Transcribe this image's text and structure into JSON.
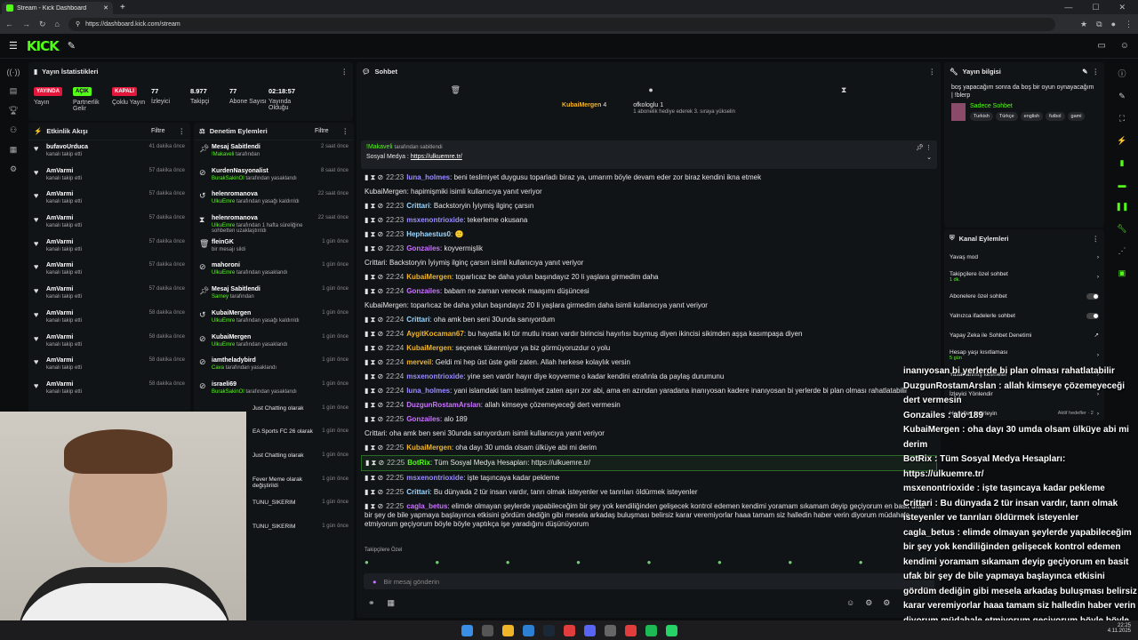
{
  "browser": {
    "tab_title": "Stream - Kick Dashboard",
    "url": "https://dashboard.kick.com/stream"
  },
  "logo": "KICK",
  "stats": {
    "title": "Yayın İstatistikleri",
    "items": [
      {
        "badge": "YAYINDA",
        "badge_color": "#e3173a",
        "label": "Yayın"
      },
      {
        "badge": "AÇIK",
        "badge_color": "#53fc18",
        "label": "Partnerlik Gelir"
      },
      {
        "badge": "KAPALI",
        "badge_color": "#e3173a",
        "label": "Çoklu Yayın"
      },
      {
        "value": "77",
        "label": "İzleyici"
      },
      {
        "value": "8.977",
        "label": "Takipçi"
      },
      {
        "value": "77",
        "label": "Abone Sayısı"
      },
      {
        "value": "02:18:57",
        "label": "Yayında Olduğu"
      }
    ]
  },
  "activity": {
    "title": "Etkinlik Akışı",
    "filter": "Filtre",
    "items": [
      {
        "name": "bufavoUrduca",
        "sub": "kanalı takip etti",
        "time": "41 dakika önce"
      },
      {
        "name": "AmVarmi",
        "sub": "kanalı takip etti",
        "time": "57 dakika önce"
      },
      {
        "name": "AmVarmi",
        "sub": "kanalı takip etti",
        "time": "57 dakika önce"
      },
      {
        "name": "AmVarmi",
        "sub": "kanalı takip etti",
        "time": "57 dakika önce"
      },
      {
        "name": "AmVarmi",
        "sub": "kanalı takip etti",
        "time": "57 dakika önce"
      },
      {
        "name": "AmVarmi",
        "sub": "kanalı takip etti",
        "time": "57 dakika önce"
      },
      {
        "name": "AmVarmi",
        "sub": "kanalı takip etti",
        "time": "57 dakika önce"
      },
      {
        "name": "AmVarmi",
        "sub": "kanalı takip etti",
        "time": "58 dakika önce"
      },
      {
        "name": "AmVarmi",
        "sub": "kanalı takip etti",
        "time": "58 dakika önce"
      },
      {
        "name": "AmVarmi",
        "sub": "kanalı takip etti",
        "time": "58 dakika önce"
      },
      {
        "name": "AmVarmi",
        "sub": "kanalı takip etti",
        "time": "58 dakika önce"
      }
    ]
  },
  "moderation": {
    "title": "Denetim Eylemleri",
    "filter": "Filtre",
    "items": [
      {
        "name": "Mesaj Sabitlendi",
        "who": "!Makaveli",
        "sub": "tarafından",
        "time": "2 saat önce"
      },
      {
        "name": "KurdenNasyonalist",
        "who": "BurakSakinOl",
        "sub": "tarafından yasaklandı",
        "time": "8 saat önce"
      },
      {
        "name": "helenromanova",
        "who": "UlkuEmre",
        "sub": "tarafından yasağı kaldırıldı",
        "time": "22 saat önce"
      },
      {
        "name": "helenromanova",
        "who": "UlkuEmre",
        "sub": "tarafından 1 hafta süreliğine sohbetten uzaklaştırıldı",
        "time": "22 saat önce"
      },
      {
        "name": "fleinGK",
        "who": "",
        "sub": "bir mesajı sildi",
        "time": "1 gün önce"
      },
      {
        "name": "mahoroni",
        "who": "UlkuEmre",
        "sub": "tarafından yasaklandı",
        "time": "1 gün önce"
      },
      {
        "name": "Mesaj Sabitlendi",
        "who": "Sarney",
        "sub": "tarafından",
        "time": "1 gün önce"
      },
      {
        "name": "KubaiMergen",
        "who": "UlkuEmre",
        "sub": "tarafından yasağı kaldırıldı",
        "time": "1 gün önce"
      },
      {
        "name": "KubaiMergen",
        "who": "UlkuEmre",
        "sub": "tarafından yasaklandı",
        "time": "1 gün önce"
      },
      {
        "name": "iamtheladybird",
        "who": "Cava",
        "sub": "tarafından yasaklandı",
        "time": "1 gün önce"
      },
      {
        "name": "israeli69",
        "who": "BurakSakinOl",
        "sub": "tarafından yasaklandı",
        "time": "1 gün önce"
      }
    ]
  },
  "mod_partial": [
    {
      "text": "Just Chatting olarak",
      "time": "1 gün önce"
    },
    {
      "text": "EA Sports FC 26 olarak",
      "time": "1 gün önce"
    },
    {
      "text": "Just Chatting olarak",
      "time": "1 gün önce"
    },
    {
      "text": "Fever Meme olarak değiştirildi",
      "time": "1 gün önce"
    },
    {
      "text": "TUNU_SIKERIM",
      "time": "1 gün önce"
    },
    {
      "text": "TUNU_SIKERIM",
      "time": "1 gün önce"
    }
  ],
  "chat": {
    "title": "Sohbet",
    "top_user": "KubaiMergen",
    "top_count": "4",
    "gift_user": "ofkologlu",
    "gift_text": "1 abonelik hediye ederek 3. sıraya yükselin",
    "gift_count": "1",
    "pinned_by": "!Makaveli",
    "pinned_sub": "tarafından sabitlendi",
    "pinned_label": "Sosyal Medya :",
    "pinned_link": "https://ulkuemre.tr/",
    "messages": [
      {
        "time": "22:23",
        "user": "luna_holmes",
        "color": "#9b8cff",
        "text": "beni teslimiyet duygusu toparladı biraz ya, umarım böyle devam eder zor biraz kendini ikna etmek"
      },
      {
        "note": "KubaiMergen: hapimişmiki isimli kullanıcıya yanıt veriyor"
      },
      {
        "time": "22:23",
        "user": "Crittari",
        "color": "#9bd7ff",
        "text": "Backstoryin İyiymiş ilginç çarsın"
      },
      {
        "time": "22:23",
        "user": "msxenontrioxide",
        "color": "#9b8cff",
        "text": "tekerleme okusana"
      },
      {
        "time": "22:23",
        "user": "Hephaestus0",
        "color": "#9bd7ff",
        "text": "🙂"
      },
      {
        "time": "22:23",
        "user": "Gonzailes",
        "color": "#c874ff",
        "text": "koyvermişlik"
      },
      {
        "note": "Crittari: Backstoryin İyiymiş ilginç çarsın isimli kullanıcıya yanıt veriyor"
      },
      {
        "time": "22:24",
        "user": "KubaiMergen",
        "color": "#f0b429",
        "text": "toparlıcaz be daha yolun başındayız 20 li yaşlara girmedim daha"
      },
      {
        "time": "22:24",
        "user": "Gonzailes",
        "color": "#c874ff",
        "text": "babam ne zaman verecek maaşımı düşüncesi"
      },
      {
        "note": "KubaiMergen: toparlıcaz be daha yolun başındayız 20 li yaşlara girmedim daha isimli kullanıcıya yanıt veriyor"
      },
      {
        "time": "22:24",
        "user": "Crittari",
        "color": "#9bd7ff",
        "text": "oha amk ben seni 30unda sanıyordum"
      },
      {
        "time": "22:24",
        "user": "AygitKocaman67",
        "color": "#f0b429",
        "text": "bu hayatta iki tür mutlu insan vardır birincisi hayırlısı buymuş diyen ikincisi sikimden aşşa kasımpaşa diyen"
      },
      {
        "time": "22:24",
        "user": "KubaiMergen",
        "color": "#f0b429",
        "text": "seçenek tükenmiyor ya biz görmüyoruzdur o yolu"
      },
      {
        "time": "22:24",
        "user": "merveil",
        "color": "#f0b429",
        "text": "Geldi mi hep üst üste gelir zaten. Allah herkese kolaylık versin"
      },
      {
        "time": "22:24",
        "user": "msxenontrioxide",
        "color": "#9b8cff",
        "text": "yine sen vardır hayır diye koyverme o kadar kendini etrafınla da paylaş durumunu"
      },
      {
        "time": "22:24",
        "user": "luna_holmes",
        "color": "#9b8cff",
        "text": "yani islamdaki tam teslimiyet zaten aşırı zor abi, ama en azından yaradana inanıyosan kadere inanıyosan bi yerlerde bi plan olması rahatlatabilir"
      },
      {
        "time": "22:24",
        "user": "DuzgunRostamArslan",
        "color": "#c874ff",
        "text": "allah kimseye çözemeyeceği dert vermesin"
      },
      {
        "time": "22:25",
        "user": "Gonzailes",
        "color": "#c874ff",
        "text": "alo 189"
      },
      {
        "note": "Crittari: oha amk ben seni 30unda sanıyordum isimli kullanıcıya yanıt veriyor"
      },
      {
        "time": "22:25",
        "user": "KubaiMergen",
        "color": "#f0b429",
        "text": "oha dayı 30 umda olsam ülküye abi mi derim"
      },
      {
        "time": "22:25",
        "user": "BotRix",
        "color": "#53fc18",
        "text": "Tüm Sosyal Medya Hesapları: https://ulkuemre.tr/",
        "hl": true
      },
      {
        "time": "22:25",
        "user": "msxenontrioxide",
        "color": "#9b8cff",
        "text": "işte taşıncaya kadar pekleme"
      },
      {
        "time": "22:25",
        "user": "Crittari",
        "color": "#9bd7ff",
        "text": "Bu dünyada 2 tür insan vardır, tanrı olmak isteyenler ve tanrıları öldürmek isteyenler"
      },
      {
        "time": "22:25",
        "user": "cagla_betus",
        "color": "#c874ff",
        "text": "elimde olmayan şeylerde yapabileceğim bir şey yok kendiliğinden gelişecek kontrol edemen kendimi yoramam sıkamam deyip geçiyorum en basit ufak bir şey de bile yapmaya başlayınca etkisini gördüm dediğin gibi mesela arkadaş buluşması belirsiz karar veremiyorlar haaa tamam siz halledin haber verin diyorum müdahale etmiyorum geçiyorum böyle böyle yaptıkça işe yaradığını düşünüyorum"
      }
    ],
    "followers_label": "Takipçilere Özel",
    "input_placeholder": "Bir mesaj gönderin"
  },
  "info": {
    "title": "Yayın bilgisi",
    "stream_title": "boş yapacağım sonra da boş bir oyun oynayacağım | !blerp",
    "category": "Sadece Sohbet",
    "tags": [
      "Turkish",
      "Türkçe",
      "english",
      "futbol",
      "gami"
    ]
  },
  "actions": {
    "title": "Kanal Eylemleri",
    "items": [
      {
        "label": "Yavaş mod",
        "kind": "arrow"
      },
      {
        "label": "Takipçilere özel sohbet",
        "sub": "1 dk.",
        "kind": "arrow"
      },
      {
        "label": "Abonelere özel sohbet",
        "kind": "toggle"
      },
      {
        "label": "Yalnızca ifadelerle sohbet",
        "kind": "toggle"
      },
      {
        "label": "Yapay Zeka ile Sohbet Denetimi",
        "kind": "link"
      },
      {
        "label": "Hesap yaşı kısıtlaması",
        "sub": "5 gün",
        "kind": "arrow"
      },
      {
        "label": "Yasaklanmış kelimeler",
        "kind": "arrow"
      },
      {
        "label": "İzleyici Yönlendir",
        "kind": "arrow"
      },
      {
        "label": "Hedefleri belirleyin",
        "extra": "Aktif hedefler · 2",
        "kind": "arrow"
      }
    ]
  },
  "overlay_lines": [
    "inanıyosan bi yerlerde bi plan olması rahatlatabilir",
    "DuzgunRostamArslan : allah kimseye çözemeyeceği dert vermesin",
    "Gonzailes : alo 189",
    "KubaiMergen : oha dayı 30 umda olsam ülküye abi mi derim",
    "BotRix : Tüm Sosyal Medya Hesapları: https://ulkuemre.tr/",
    "msxenontrioxide : işte taşıncaya kadar pekleme",
    "Crittari : Bu dünyada 2 tür insan vardır, tanrı olmak isteyenler ve tanrıları öldürmek isteyenler",
    "cagla_betus : elimde olmayan şeylerde yapabileceğim bir şey yok kendiliğinden gelişecek kontrol edemen kendimi yoramam sıkamam deyip geçiyorum en basit ufak bir şey de bile yapmaya başlayınca etkisini gördüm dediğin gibi mesela arkadaş buluşması belirsiz karar veremiyorlar haaa tamam siz halledin haber verin diyorum müdahale etmiyorum geçiyorum böyle böyle yaptıkça işe yaradığını düşünüyorum"
  ],
  "tray": {
    "time": "22:25",
    "date": "4.11.2025"
  }
}
